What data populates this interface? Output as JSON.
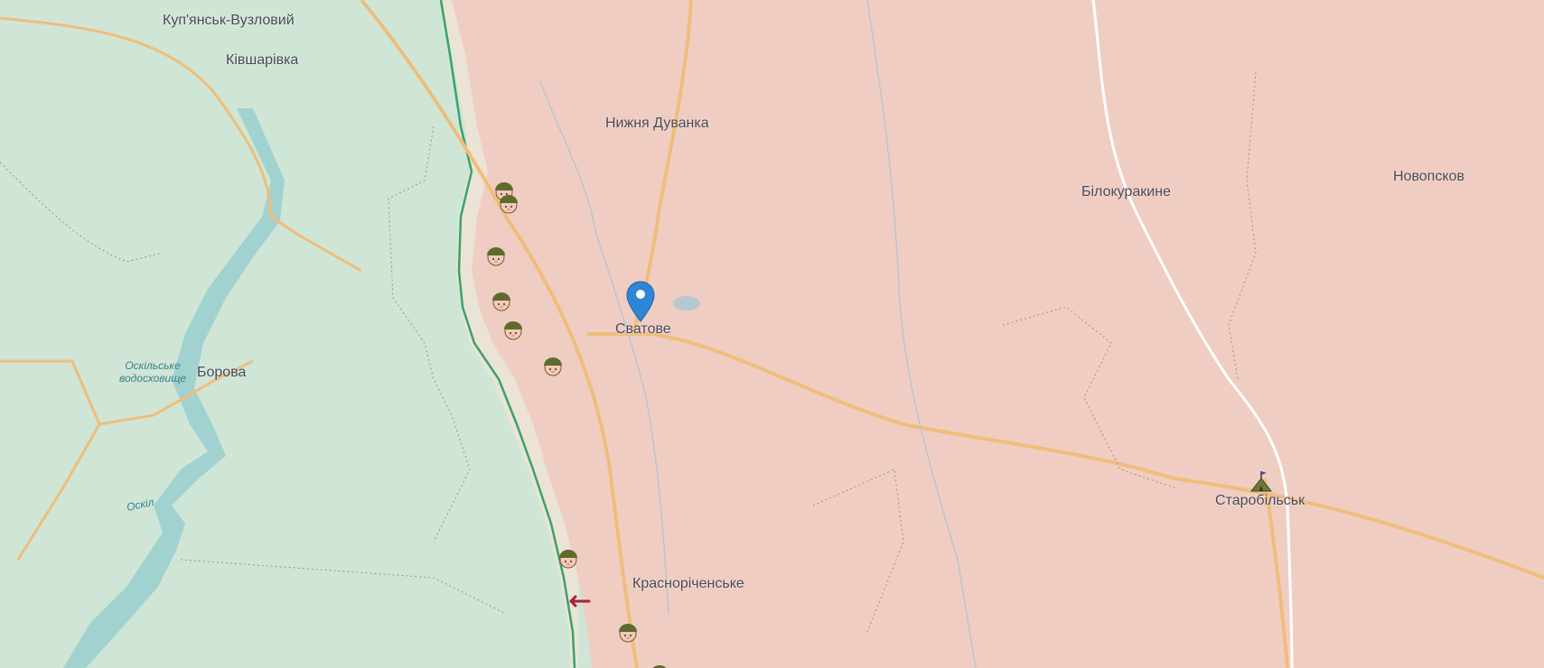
{
  "map": {
    "colors": {
      "free_territory": "#cfe6d6",
      "occupied_territory": "#f0cdc2",
      "gray_zone": "#ece3d7",
      "front_line": "#3aa36a",
      "water": "#9ccfcf",
      "road": "#efbd7c",
      "highway_white": "#ffffff",
      "pin": "#2e86d4",
      "arrow": "#a3233a"
    },
    "towns": [
      {
        "id": "kupiansk-vuzlovyi",
        "name": "Куп'янськ-Вузловий"
      },
      {
        "id": "kivsharivka",
        "name": "Ківшарівка"
      },
      {
        "id": "borova",
        "name": "Борова"
      },
      {
        "id": "nyzhnia-duvanka",
        "name": "Нижня Дуванка"
      },
      {
        "id": "svatove",
        "name": "Сватове"
      },
      {
        "id": "krasnorichenske",
        "name": "Красноріченське"
      },
      {
        "id": "bilokurakyne",
        "name": "Білокуракине"
      },
      {
        "id": "novopskov",
        "name": "Новопсков"
      },
      {
        "id": "starobilsk",
        "name": "Старобільськ"
      }
    ],
    "water_labels": {
      "reservoir": [
        "Оскільське",
        "водосховище"
      ],
      "river": "Оскіл"
    },
    "markers": {
      "selected_location_pin": "map-pin-icon",
      "unit_icon": "soldier-helmet-icon",
      "attack_arrow": "attack-arrow-icon",
      "headquarters_icon": "tent-flag-icon"
    }
  }
}
